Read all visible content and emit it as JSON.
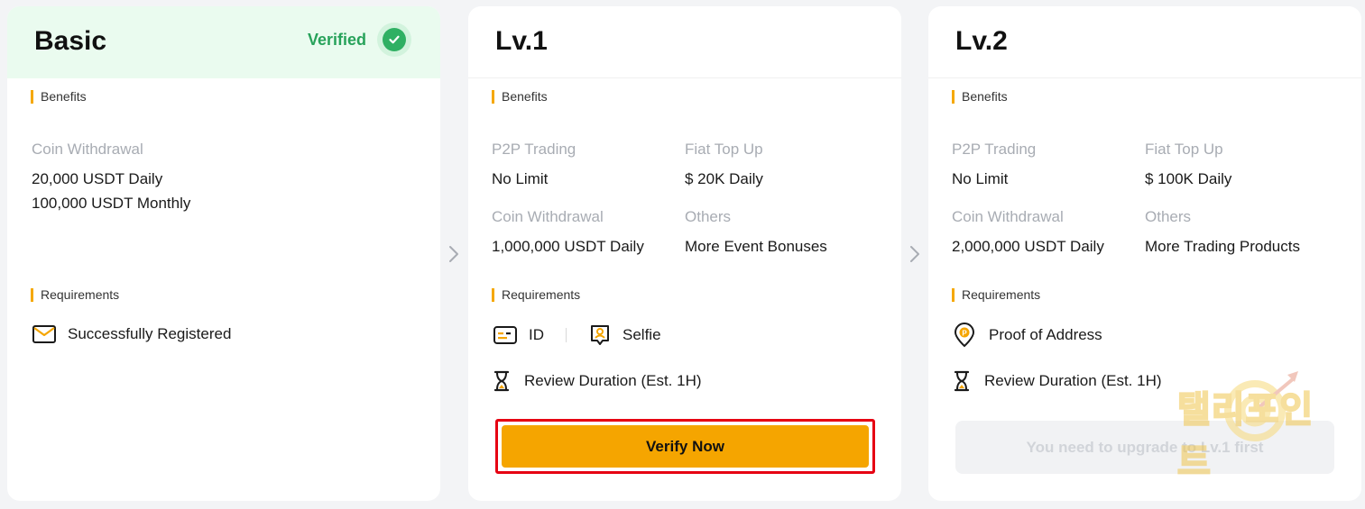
{
  "cards": {
    "basic": {
      "title": "Basic",
      "status": "Verified",
      "benefits_label": "Benefits",
      "benefits": [
        {
          "label": "Coin Withdrawal",
          "values": [
            "20,000 USDT Daily",
            "100,000 USDT Monthly"
          ]
        }
      ],
      "requirements_label": "Requirements",
      "requirements": [
        {
          "icon": "envelope-icon",
          "text": "Successfully Registered"
        }
      ]
    },
    "lv1": {
      "title": "Lv.1",
      "benefits_label": "Benefits",
      "benefits": [
        {
          "label": "P2P Trading",
          "value": "No Limit"
        },
        {
          "label": "Fiat Top Up",
          "value": "$ 20K Daily"
        },
        {
          "label": "Coin Withdrawal",
          "value": "1,000,000 USDT Daily"
        },
        {
          "label": "Others",
          "value": "More Event Bonuses"
        }
      ],
      "requirements_label": "Requirements",
      "requirements": [
        {
          "icon": "id-card-icon",
          "text": "ID"
        },
        {
          "icon": "selfie-icon",
          "text": "Selfie"
        }
      ],
      "review": {
        "icon": "hourglass-icon",
        "text": "Review Duration (Est. 1H)"
      },
      "button_label": "Verify Now"
    },
    "lv2": {
      "title": "Lv.2",
      "benefits_label": "Benefits",
      "benefits": [
        {
          "label": "P2P Trading",
          "value": "No Limit"
        },
        {
          "label": "Fiat Top Up",
          "value": "$ 100K Daily"
        },
        {
          "label": "Coin Withdrawal",
          "value": "2,000,000 USDT Daily"
        },
        {
          "label": "Others",
          "value": "More Trading Products"
        }
      ],
      "requirements_label": "Requirements",
      "requirements": [
        {
          "icon": "location-pin-icon",
          "text": "Proof of Address"
        }
      ],
      "review": {
        "icon": "hourglass-icon",
        "text": "Review Duration (Est. 1H)"
      },
      "button_label": "You need to upgrade to Lv.1 first"
    }
  },
  "watermark": {
    "text": "탤리포인트"
  },
  "colors": {
    "accent": "#f5a500",
    "verified_green": "#2fb063",
    "highlight_red": "#e60012",
    "label_gray": "#a8acb3"
  }
}
